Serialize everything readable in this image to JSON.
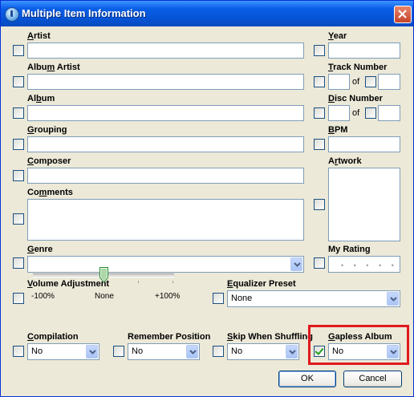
{
  "window": {
    "title": "Multiple Item Information"
  },
  "fields": {
    "artist": {
      "pre": "",
      "ul": "A",
      "post": "rtist"
    },
    "album_artist": {
      "pre": "Albu",
      "ul": "m",
      "post": " Artist"
    },
    "album": {
      "pre": "Al",
      "ul": "b",
      "post": "um"
    },
    "grouping": {
      "pre": "",
      "ul": "G",
      "post": "rouping"
    },
    "composer": {
      "pre": "",
      "ul": "C",
      "post": "omposer"
    },
    "comments": {
      "pre": "Co",
      "ul": "m",
      "post": "ments"
    },
    "genre": {
      "pre": "",
      "ul": "G",
      "post": "enre"
    },
    "volume": {
      "pre": "",
      "ul": "V",
      "post": "olume Adjustment"
    },
    "equalizer": {
      "pre": "",
      "ul": "E",
      "post": "qualizer Preset"
    },
    "year": {
      "pre": "",
      "ul": "Y",
      "post": "ear"
    },
    "track_number": {
      "pre": "",
      "ul": "T",
      "post": "rack Number"
    },
    "disc_number": {
      "pre": "",
      "ul": "D",
      "post": "isc Number"
    },
    "bpm": {
      "pre": "",
      "ul": "B",
      "post": "PM"
    },
    "artwork": {
      "pre": "A",
      "ul": "r",
      "post": "twork"
    },
    "my_rating": {
      "pre": "My Rating",
      "ul": "",
      "post": ""
    },
    "compilation": {
      "pre": "",
      "ul": "C",
      "post": "ompilation"
    },
    "remember_position": {
      "pre": "Remember Position",
      "ul": "",
      "post": ""
    },
    "skip_shuffling": {
      "pre": "",
      "ul": "S",
      "post": "kip When Shuffling"
    },
    "gapless_album": {
      "pre": "",
      "ul": "G",
      "post": "apless Album"
    }
  },
  "of_label": "of",
  "equalizer_value": "None",
  "volume": {
    "min_label": "-100%",
    "mid_label": "None",
    "max_label": "+100%",
    "value_percent": 0
  },
  "rating": {
    "stars": "• • • • •",
    "value": 0
  },
  "dropdowns": {
    "compilation": "No",
    "remember_position": "No",
    "skip_shuffling": "No",
    "gapless_album": "No"
  },
  "checkboxes": {
    "gapless_album_checked": true
  },
  "buttons": {
    "ok": "OK",
    "cancel": "Cancel"
  }
}
